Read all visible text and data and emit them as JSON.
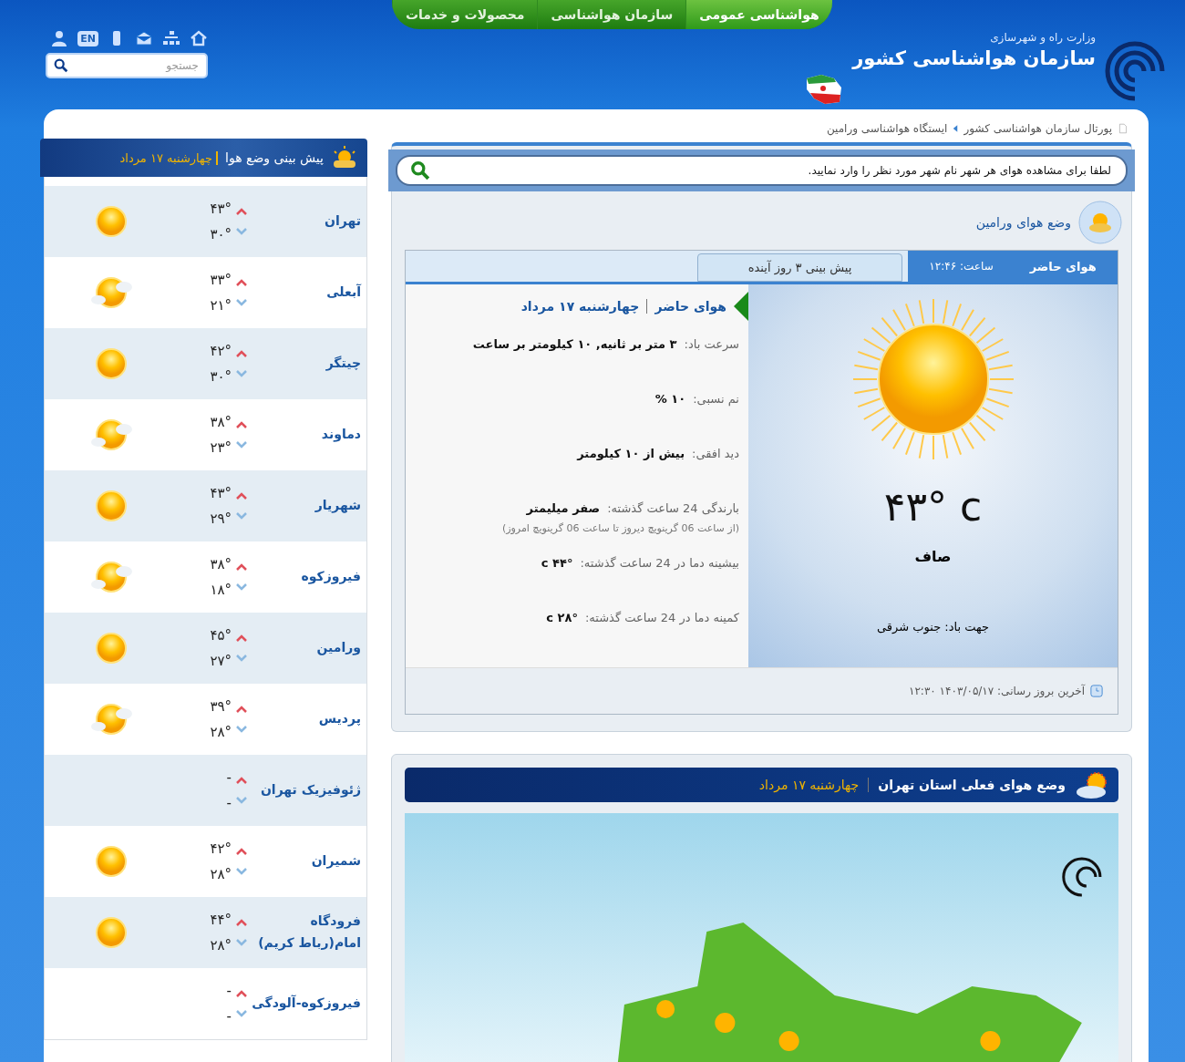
{
  "nav_tabs": [
    {
      "label": "هواشناسی عمومی",
      "selected": true
    },
    {
      "label": "سازمان هواشناسی",
      "selected": false
    },
    {
      "label": "محصولات و خدمات",
      "selected": false
    }
  ],
  "header": {
    "ministry": "وزارت راه و شهرسازی",
    "org_name": "سازمان هواشناسی کشور",
    "lang_button": "EN",
    "search": {
      "placeholder": "جستجو"
    }
  },
  "breadcrumb": [
    "پورتال سازمان هواشناسی کشور",
    "ایستگاه هواشناسی ورامین"
  ],
  "city_search": {
    "placeholder": "لطفا برای مشاهده هوای هر شهر نام شهر مورد نظر را وارد نمایید."
  },
  "station": {
    "title": "وضع هوای ورامین",
    "tabs": [
      {
        "label": "هوای حاضر",
        "selected": true,
        "time": "ساعت: ۱۲:۴۶"
      },
      {
        "label": "پیش بینی ۳ روز آینده",
        "selected": false
      }
    ],
    "heading": "هوای حاضر",
    "date": "چهارشنبه ۱۷ مرداد",
    "fields": [
      {
        "label": "سرعت باد:",
        "value": "۳ متر بر ثانیه, ۱۰ کیلومتر بر ساعت"
      },
      {
        "label": "نم نسبی:",
        "value": "۱۰ %"
      },
      {
        "label": "دید افقی:",
        "value": "بیش از ۱۰ کیلومتر"
      },
      {
        "label": "بارندگی 24 ساعت گذشته:",
        "value": "صفر میلیمتر",
        "note": "(از ساعت 06 گرینویچ دیروز تا ساعت 06 گرینویچ امروز)"
      },
      {
        "label": "بیشینه دما در 24 ساعت گذشته:",
        "value": "۴۴° c"
      },
      {
        "label": "کمینه دما در 24 ساعت گذشته:",
        "value": "۲۸° c"
      }
    ],
    "temperature": "۴۳° c",
    "condition": "صاف",
    "wind_direction": "جهت باد: جنوب شرقی",
    "last_update": "آخرین بروز رسانی: ۱۴۰۳/۰۵/۱۷ ۱۲:۳۰"
  },
  "province": {
    "title": "وضع هوای فعلی استان تهران",
    "date": "چهارشنبه ۱۷ مرداد"
  },
  "forecast": {
    "title": "پیش بینی وضع هوا",
    "date": "چهارشنبه ۱۷ مرداد",
    "rows": [
      {
        "city": "تهران",
        "high": "۴۳°",
        "low": "۳۰°",
        "kind": "sunny"
      },
      {
        "city": "آبعلی",
        "high": "۳۳°",
        "low": "۲۱°",
        "kind": "partly"
      },
      {
        "city": "چیتگر",
        "high": "۴۲°",
        "low": "۳۰°",
        "kind": "sunny"
      },
      {
        "city": "دماوند",
        "high": "۳۸°",
        "low": "۲۳°",
        "kind": "partly"
      },
      {
        "city": "شهریار",
        "high": "۴۳°",
        "low": "۲۹°",
        "kind": "sunny"
      },
      {
        "city": "فیروزکوه",
        "high": "۳۸°",
        "low": "۱۸°",
        "kind": "partly"
      },
      {
        "city": "ورامین",
        "high": "۴۵°",
        "low": "۲۷°",
        "kind": "sunny"
      },
      {
        "city": "پردیس",
        "high": "۳۹°",
        "low": "۲۸°",
        "kind": "partly"
      },
      {
        "city": "ژئوفیزیک تهران",
        "high": "-",
        "low": "-",
        "kind": "none"
      },
      {
        "city": "شمیران",
        "high": "۴۲°",
        "low": "۲۸°",
        "kind": "sunny"
      },
      {
        "city": "فرودگاه امام(رباط کریم)",
        "high": "۴۴°",
        "low": "۲۸°",
        "kind": "sunny"
      },
      {
        "city": "فیروزکوه-آلودگی",
        "high": "-",
        "low": "-",
        "kind": "none"
      }
    ]
  }
}
